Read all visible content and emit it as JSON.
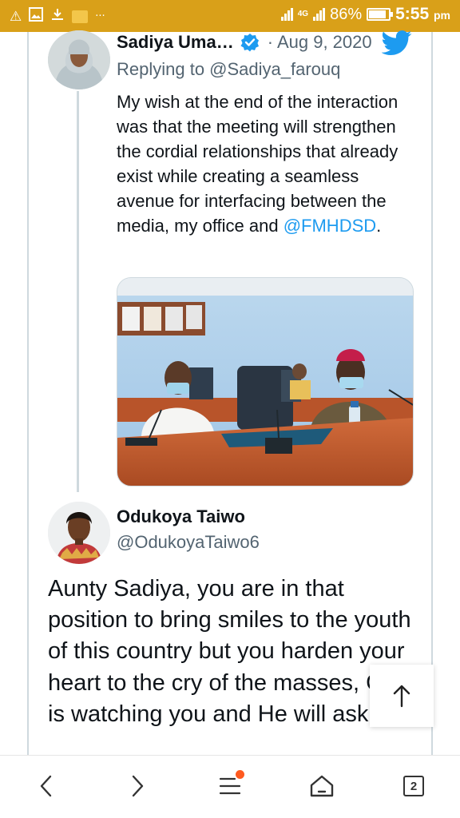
{
  "status_bar": {
    "battery": "86%",
    "battery_level": 0.86,
    "time": "5:55",
    "ampm": "pm",
    "network_label": "4G"
  },
  "quoted_tweet": {
    "author_name": "Sadiya Uma…",
    "date": "· Aug 9, 2020",
    "replying_to": "Replying to @Sadiya_farouq",
    "text": "My wish at the end of the interaction was that the meeting will strengthen the cordial relationships that already exist while creating a seamless avenue for interfacing between the media, my office and ",
    "mention": "@FMHDSD",
    "text_end": "."
  },
  "reply_tweet": {
    "author_name": "Odukoya Taiwo",
    "handle": "@OdukoyaTaiwo6",
    "text": "Aunty Sadiya, you are in that position to bring smiles to the youth of this country but you harden  your heart to the cry of the masses, God is watching you and He will ask you"
  },
  "bottom_nav": {
    "tab_count": "2"
  },
  "colors": {
    "status_bar": "#d9a019",
    "link": "#1d9bf0",
    "secondary_text": "#536471",
    "notification_dot": "#ff5a1f"
  },
  "icons": [
    "warning-icon",
    "image-icon",
    "download-icon",
    "app-icon",
    "more-icon",
    "twitter-bird-icon",
    "verified-icon",
    "scroll-top-arrow-icon",
    "back-icon",
    "forward-icon",
    "menu-icon",
    "home-icon",
    "tabs-icon"
  ]
}
